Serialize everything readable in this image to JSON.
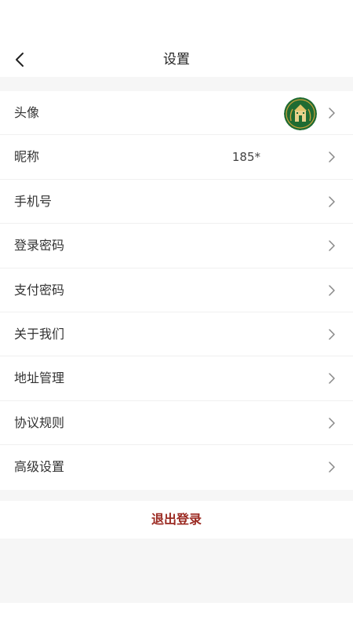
{
  "header": {
    "title": "设置"
  },
  "settings": {
    "items": [
      {
        "label": "头像",
        "value": ""
      },
      {
        "label": "昵称",
        "value": "185*"
      },
      {
        "label": "手机号",
        "value": ""
      },
      {
        "label": "登录密码",
        "value": ""
      },
      {
        "label": "支付密码",
        "value": ""
      },
      {
        "label": "关于我们",
        "value": ""
      },
      {
        "label": "地址管理",
        "value": ""
      },
      {
        "label": "协议规则",
        "value": ""
      },
      {
        "label": "高级设置",
        "value": ""
      }
    ]
  },
  "logout": {
    "label": "退出登录"
  },
  "colors": {
    "accent": "#9b2a22",
    "avatar_bg": "#1f6b32",
    "avatar_ring": "#c9a23a",
    "background": "#f6f6f6"
  },
  "icons": {
    "back": "chevron-left-icon",
    "row_arrow": "chevron-right-icon",
    "avatar": "avatar-emblem"
  }
}
